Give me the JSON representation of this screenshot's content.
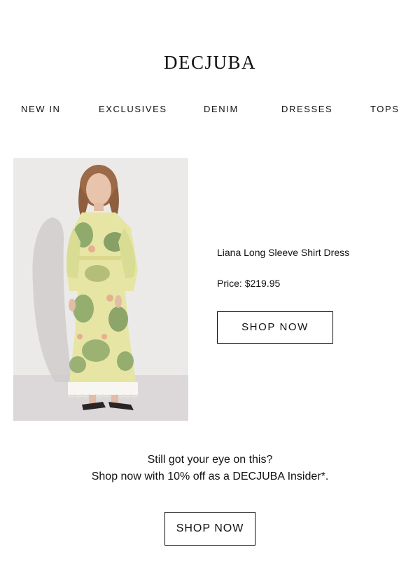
{
  "brand": {
    "logo_text": "DECJUBA"
  },
  "nav": {
    "items": [
      {
        "label": "NEW IN"
      },
      {
        "label": "EXCLUSIVES"
      },
      {
        "label": "DENIM"
      },
      {
        "label": "DRESSES"
      },
      {
        "label": "TOPS"
      }
    ]
  },
  "product": {
    "image_alt": "Model wearing floral long sleeve shirt dress",
    "name": "Liana Long Sleeve Shirt Dress",
    "price_label": "Price:",
    "price_value": "$219.95",
    "cta_label": "SHOP NOW"
  },
  "promo": {
    "line1": "Still got your eye on this?",
    "line2": "Shop now with 10% off as a DECJUBA Insider*.",
    "cta_label": "SHOP NOW"
  },
  "colors": {
    "text": "#111111",
    "background": "#ffffff",
    "image_backdrop": "#e9e7e6"
  }
}
